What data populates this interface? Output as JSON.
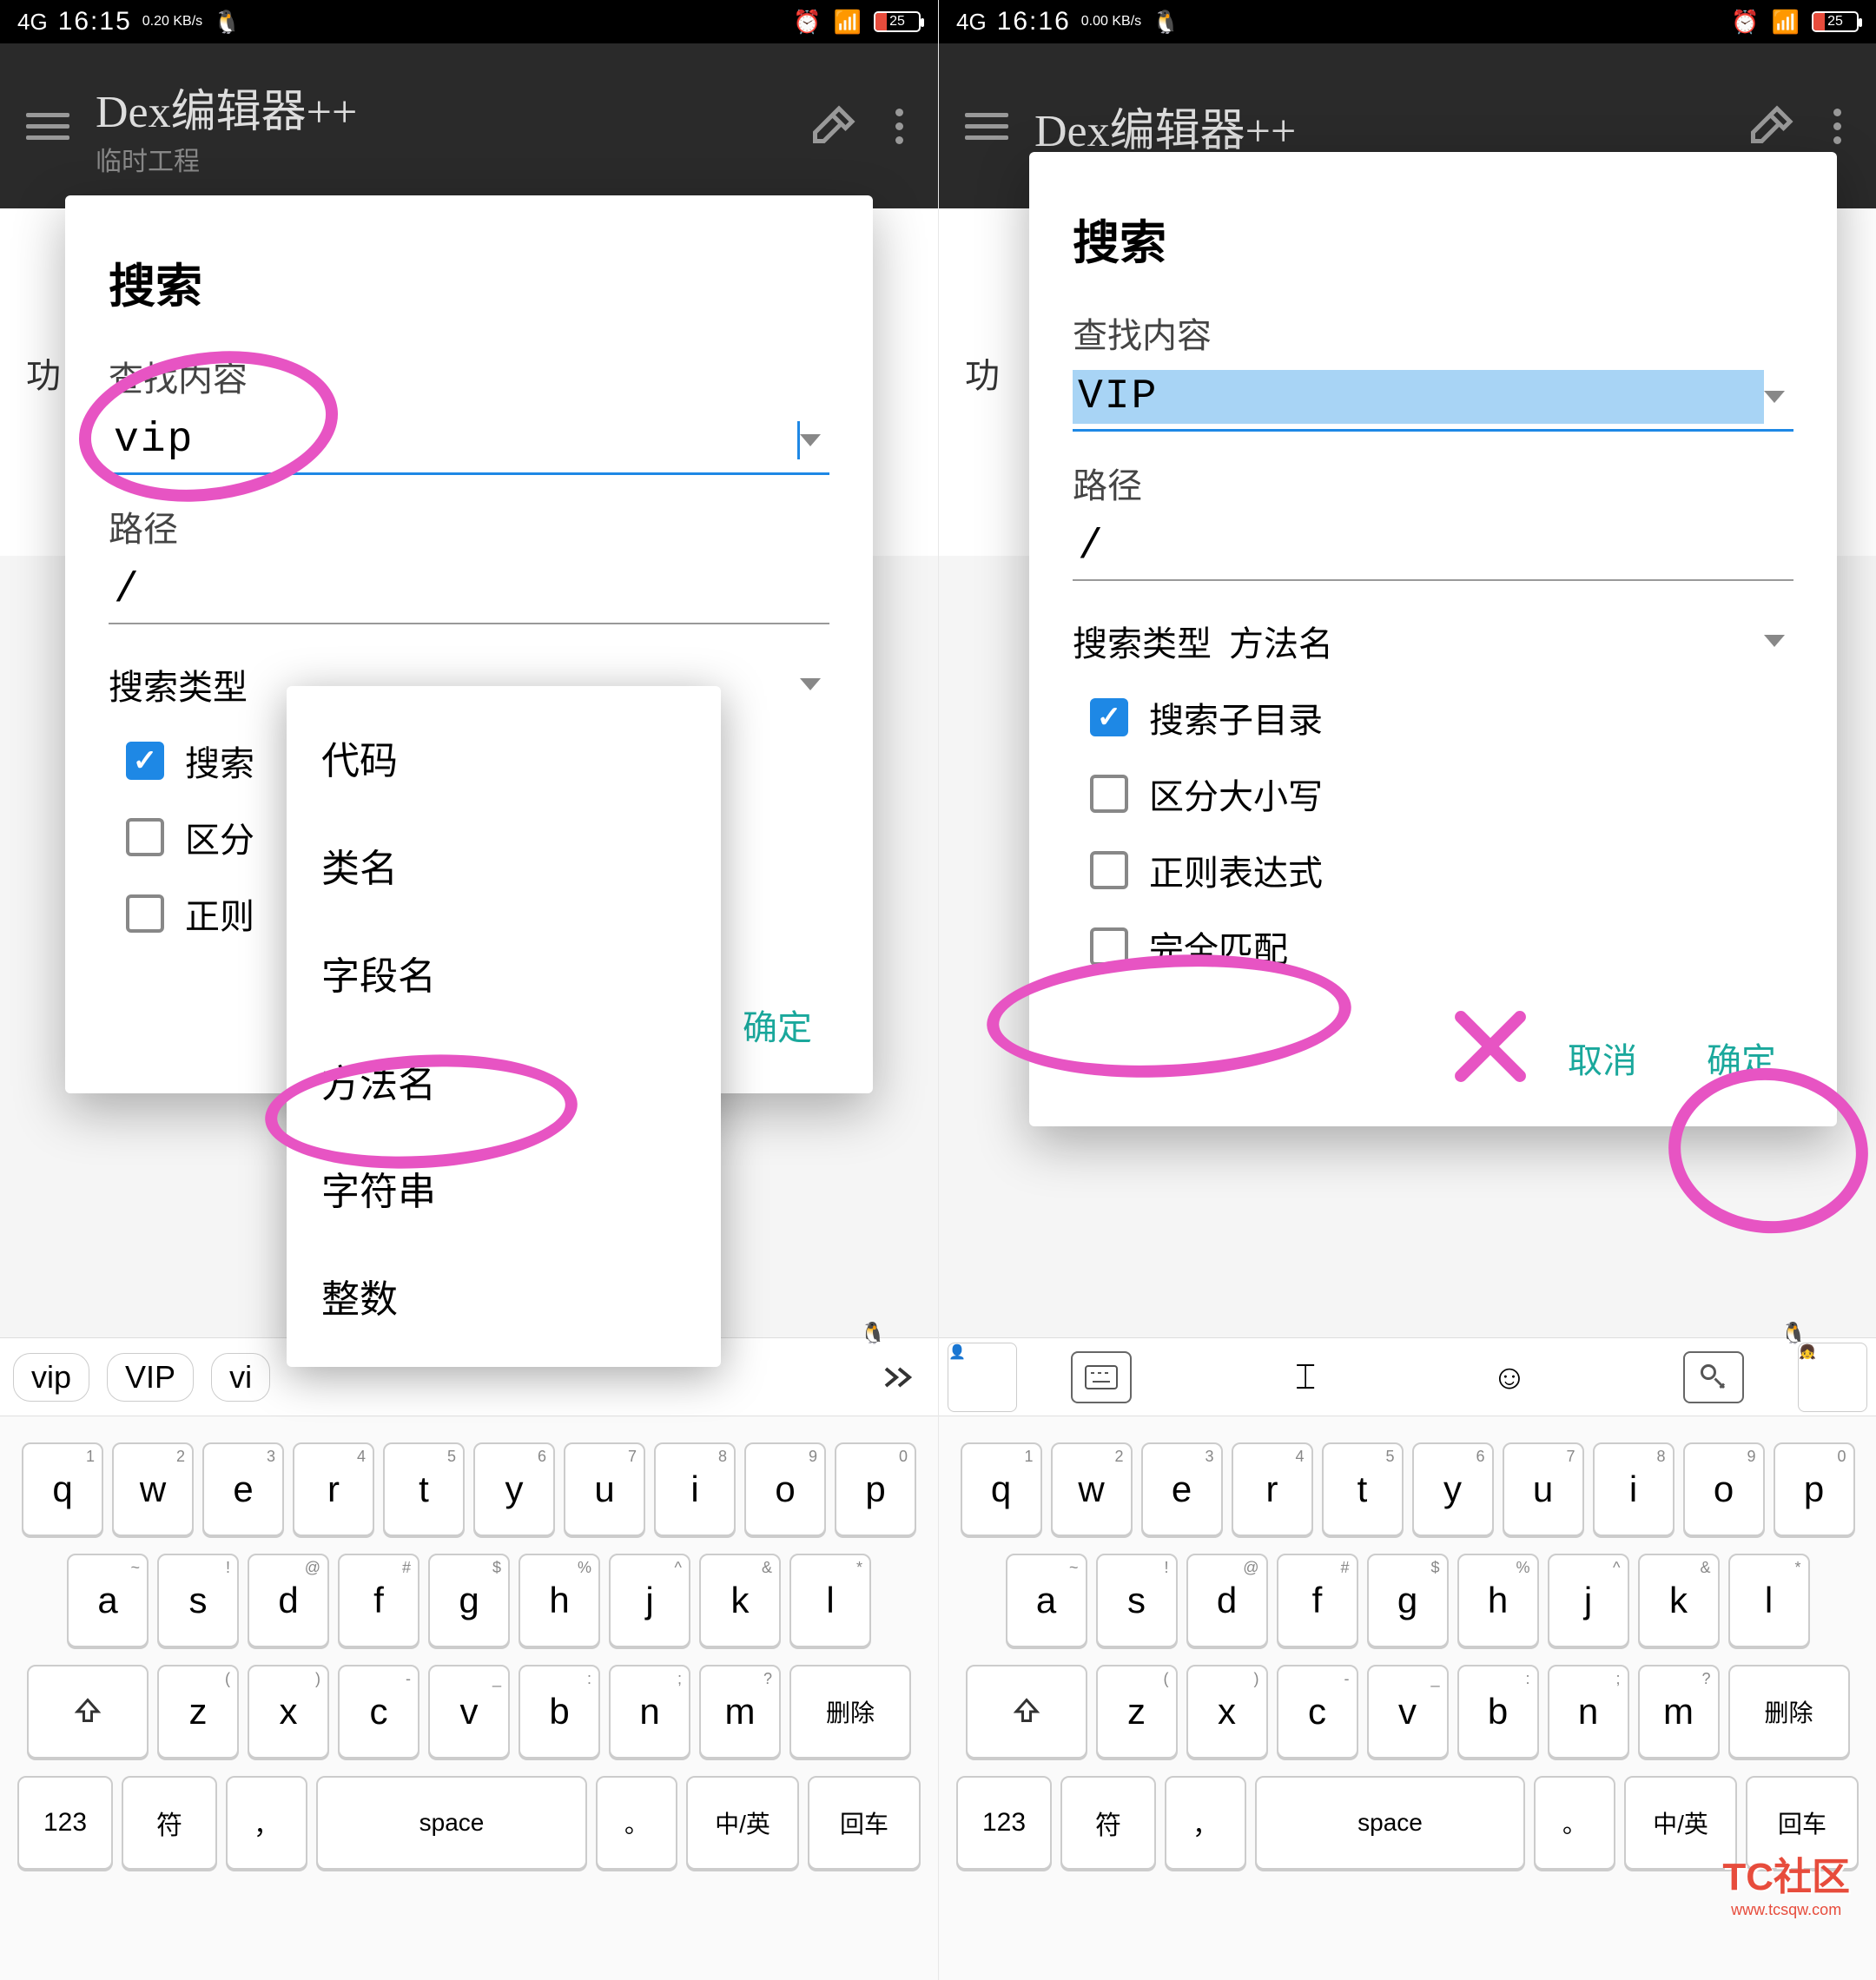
{
  "statusbar": {
    "network": "4G",
    "time_left": "16:15",
    "rate_left": "0.20 KB/s",
    "time_right": "16:16",
    "rate_right": "0.00 KB/s",
    "battery": "25"
  },
  "appbar": {
    "title": "Dex编辑器++",
    "subtitle": "临时工程"
  },
  "bg": {
    "tab_label": "功",
    "search_icon": "⌕"
  },
  "dialog": {
    "title": "搜索",
    "find_label": "查找内容",
    "path_label": "路径",
    "path_value": "/",
    "search_type_label": "搜索类型",
    "search_type_value": "方法名",
    "cb_subdir": "搜索子目录",
    "cb_case": "区分大小写",
    "cb_regex": "正则表达式",
    "cb_exact": "完全匹配",
    "cancel": "取消",
    "confirm": "确定",
    "left_input": "vip",
    "right_input": "VIP",
    "cb_subdir_short": "搜索",
    "cb_case_short": "区分",
    "cb_regex_short": "正则"
  },
  "dropdown": {
    "items": [
      "代码",
      "类名",
      "字段名",
      "方法名",
      "字符串",
      "整数"
    ]
  },
  "suggestions": {
    "left": [
      "vip",
      "VIP",
      "vi"
    ]
  },
  "keyboard": {
    "row1": [
      "q",
      "w",
      "e",
      "r",
      "t",
      "y",
      "u",
      "i",
      "o",
      "p"
    ],
    "row1_sub": [
      "1",
      "2",
      "3",
      "4",
      "5",
      "6",
      "7",
      "8",
      "9",
      "0"
    ],
    "row2": [
      "a",
      "s",
      "d",
      "f",
      "g",
      "h",
      "j",
      "k",
      "l"
    ],
    "row2_sub": [
      "~",
      "!",
      "@",
      "#",
      "$",
      "%",
      "^",
      "&",
      "*"
    ],
    "row3_mid": [
      "z",
      "x",
      "c",
      "v",
      "b",
      "n",
      "m"
    ],
    "row3_sub": [
      "(",
      ")",
      "-",
      "_",
      ":",
      ";",
      "?"
    ],
    "delete": "删除",
    "num": "123",
    "sym": "符",
    "comma": "，",
    "space": "space",
    "period": "。",
    "lang": "中/英",
    "enter": "回车"
  },
  "watermark": {
    "top": "TC社区",
    "sub": "www.tcsqw.com"
  }
}
